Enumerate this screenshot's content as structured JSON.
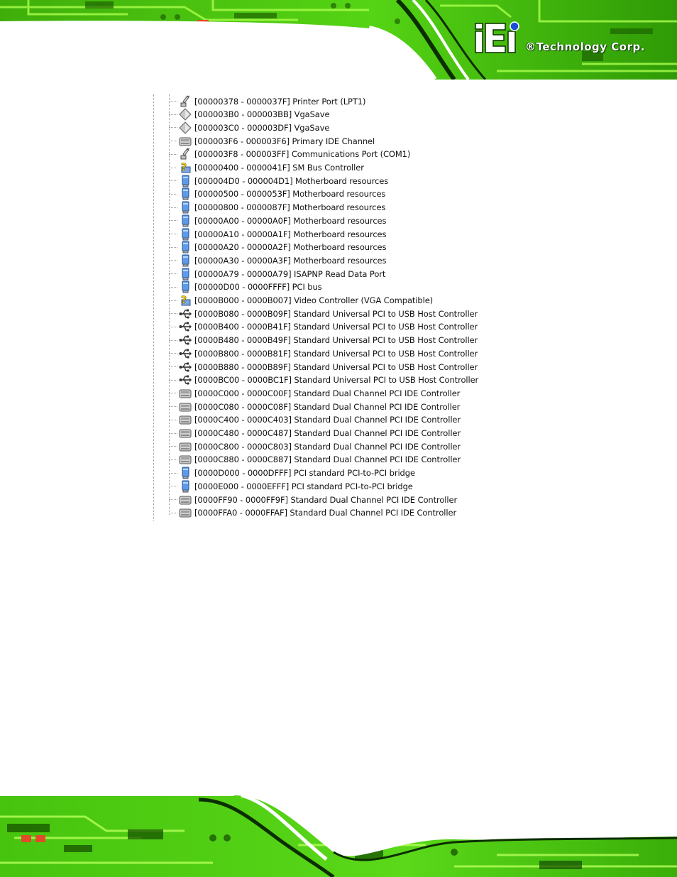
{
  "header": {
    "brand": "®Technology Corp."
  },
  "colors": {
    "pcb_green": "#4fd10f",
    "pcb_dark": "#1f6b00",
    "trace": "#9cff3a",
    "logo_blue": "#1a4fd6"
  },
  "rows": [
    {
      "text": "[00000378 - 0000037F]  Printer Port (LPT1)",
      "icon": "port-icon"
    },
    {
      "text": "[000003B0 - 000003BB]  VgaSave",
      "icon": "device-diamond-icon"
    },
    {
      "text": "[000003C0 - 000003DF]  VgaSave",
      "icon": "device-diamond-icon"
    },
    {
      "text": "[000003F6 - 000003F6]  Primary IDE Channel",
      "icon": "ide-controller-icon"
    },
    {
      "text": "[000003F8 - 000003FF]  Communications Port (COM1)",
      "icon": "port-icon"
    },
    {
      "text": "[00000400 - 0000041F]  SM Bus Controller",
      "icon": "unknown-device-icon"
    },
    {
      "text": "[000004D0 - 000004D1]  Motherboard resources",
      "icon": "system-device-icon"
    },
    {
      "text": "[00000500 - 0000053F]  Motherboard resources",
      "icon": "system-device-icon"
    },
    {
      "text": "[00000800 - 0000087F]  Motherboard resources",
      "icon": "system-device-icon"
    },
    {
      "text": "[00000A00 - 00000A0F]  Motherboard resources",
      "icon": "system-device-icon"
    },
    {
      "text": "[00000A10 - 00000A1F]  Motherboard resources",
      "icon": "system-device-icon"
    },
    {
      "text": "[00000A20 - 00000A2F]  Motherboard resources",
      "icon": "system-device-icon"
    },
    {
      "text": "[00000A30 - 00000A3F]  Motherboard resources",
      "icon": "system-device-icon"
    },
    {
      "text": "[00000A79 - 00000A79]  ISAPNP Read Data Port",
      "icon": "system-device-icon"
    },
    {
      "text": "[00000D00 - 0000FFFF]  PCI bus",
      "icon": "system-device-icon"
    },
    {
      "text": "[0000B000 - 0000B007]  Video Controller (VGA Compatible)",
      "icon": "unknown-device-icon"
    },
    {
      "text": "[0000B080 - 0000B09F]  Standard Universal PCI to USB Host Controller",
      "icon": "usb-icon"
    },
    {
      "text": "[0000B400 - 0000B41F]  Standard Universal PCI to USB Host Controller",
      "icon": "usb-icon"
    },
    {
      "text": "[0000B480 - 0000B49F]  Standard Universal PCI to USB Host Controller",
      "icon": "usb-icon"
    },
    {
      "text": "[0000B800 - 0000B81F]  Standard Universal PCI to USB Host Controller",
      "icon": "usb-icon"
    },
    {
      "text": "[0000B880 - 0000B89F]  Standard Universal PCI to USB Host Controller",
      "icon": "usb-icon"
    },
    {
      "text": "[0000BC00 - 0000BC1F]  Standard Universal PCI to USB Host Controller",
      "icon": "usb-icon"
    },
    {
      "text": "[0000C000 - 0000C00F]  Standard Dual Channel PCI IDE Controller",
      "icon": "ide-controller-icon"
    },
    {
      "text": "[0000C080 - 0000C08F]  Standard Dual Channel PCI IDE Controller",
      "icon": "ide-controller-icon"
    },
    {
      "text": "[0000C400 - 0000C403]  Standard Dual Channel PCI IDE Controller",
      "icon": "ide-controller-icon"
    },
    {
      "text": "[0000C480 - 0000C487]  Standard Dual Channel PCI IDE Controller",
      "icon": "ide-controller-icon"
    },
    {
      "text": "[0000C800 - 0000C803]  Standard Dual Channel PCI IDE Controller",
      "icon": "ide-controller-icon"
    },
    {
      "text": "[0000C880 - 0000C887]  Standard Dual Channel PCI IDE Controller",
      "icon": "ide-controller-icon"
    },
    {
      "text": "[0000D000 - 0000DFFF]  PCI standard PCI-to-PCI bridge",
      "icon": "system-device-icon"
    },
    {
      "text": "[0000E000 - 0000EFFF]  PCI standard PCI-to-PCI bridge",
      "icon": "system-device-icon"
    },
    {
      "text": "[0000FF90 - 0000FF9F]  Standard Dual Channel PCI IDE Controller",
      "icon": "ide-controller-icon"
    },
    {
      "text": "[0000FFA0 - 0000FFAF]  Standard Dual Channel PCI IDE Controller",
      "icon": "ide-controller-icon"
    }
  ]
}
